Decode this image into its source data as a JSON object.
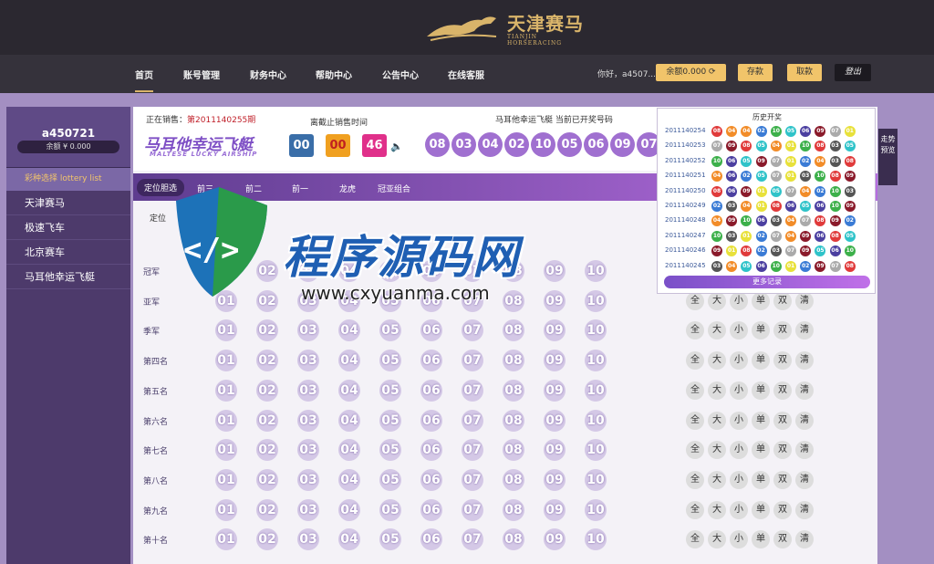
{
  "brand": {
    "name_cn": "天津赛马",
    "name_en": "TIANJIN HORSERACING"
  },
  "nav": {
    "items": [
      "首页",
      "账号管理",
      "财务中心",
      "帮助中心",
      "公告中心",
      "在线客服"
    ],
    "greeting": "你好，a4507...",
    "balance_btn": "余额0.000 ⟳",
    "deposit": "存款",
    "withdraw": "取款",
    "logout": "登出"
  },
  "sidebar": {
    "username": "a450721",
    "balance": "余额 ¥ 0.000",
    "title": "彩种选择 lottery list",
    "items": [
      "天津赛马",
      "极速飞车",
      "北京赛车",
      "马耳他幸运飞艇"
    ]
  },
  "header": {
    "on_sale_label": "正在销售：",
    "on_sale_period": "第2011140255期",
    "game_name": "马耳他幸运飞艇",
    "game_name_en": "MALTESE LUCKY AIRSHIP",
    "countdown_label": "离截止销售时间",
    "countdown": [
      "00",
      "00",
      "46"
    ],
    "current_label": "马耳他幸运飞艇 当前已开奖号码",
    "results": [
      "08",
      "03",
      "04",
      "02",
      "10",
      "05",
      "06",
      "09",
      "07"
    ]
  },
  "tabs": [
    "定位胆选",
    "前三",
    "前二",
    "前一",
    "龙虎",
    "冠亚组合"
  ],
  "subtab": "定位",
  "rows": [
    "冠军",
    "亚军",
    "季军",
    "第四名",
    "第五名",
    "第六名",
    "第七名",
    "第八名",
    "第九名",
    "第十名"
  ],
  "numbers": [
    "01",
    "02",
    "03",
    "04",
    "05",
    "06",
    "07",
    "08",
    "09",
    "10"
  ],
  "quick": [
    "全",
    "大",
    "小",
    "单",
    "双",
    "清"
  ],
  "history": {
    "title": "历史开奖",
    "more": "更多记录",
    "records": [
      {
        "id": "2011140254",
        "n": [
          "08",
          "04",
          "04",
          "02",
          "10",
          "05",
          "06",
          "09",
          "07",
          "01"
        ]
      },
      {
        "id": "2011140253",
        "n": [
          "07",
          "09",
          "08",
          "05",
          "04",
          "01",
          "10",
          "08",
          "03",
          "05"
        ]
      },
      {
        "id": "2011140252",
        "n": [
          "10",
          "06",
          "05",
          "09",
          "07",
          "01",
          "02",
          "04",
          "03",
          "08"
        ]
      },
      {
        "id": "2011140251",
        "n": [
          "04",
          "06",
          "02",
          "05",
          "07",
          "01",
          "03",
          "10",
          "08",
          "09"
        ]
      },
      {
        "id": "2011140250",
        "n": [
          "08",
          "06",
          "09",
          "01",
          "05",
          "07",
          "04",
          "02",
          "10",
          "03"
        ]
      },
      {
        "id": "2011140249",
        "n": [
          "02",
          "03",
          "04",
          "01",
          "08",
          "06",
          "05",
          "06",
          "10",
          "09"
        ]
      },
      {
        "id": "2011140248",
        "n": [
          "04",
          "09",
          "10",
          "06",
          "03",
          "04",
          "07",
          "08",
          "09",
          "02"
        ]
      },
      {
        "id": "2011140247",
        "n": [
          "10",
          "03",
          "01",
          "02",
          "07",
          "04",
          "09",
          "06",
          "08",
          "05"
        ]
      },
      {
        "id": "2011140246",
        "n": [
          "09",
          "01",
          "08",
          "02",
          "03",
          "07",
          "09",
          "05",
          "06",
          "10"
        ]
      },
      {
        "id": "2011140245",
        "n": [
          "03",
          "04",
          "05",
          "06",
          "10",
          "01",
          "02",
          "09",
          "07",
          "08"
        ]
      }
    ]
  },
  "trend": "走势预览",
  "watermark": {
    "title": "程序源码网",
    "url": "www.cxyuanma.com"
  },
  "colors": {
    "b01": "#e8e13a",
    "b02": "#3a7bd5",
    "b03": "#555555",
    "b04": "#f28c28",
    "b05": "#2fc3c9",
    "b06": "#4b3fa0",
    "b07": "#aaaaaa",
    "b08": "#e03a3a",
    "b09": "#8a1a2a",
    "b10": "#3cb04a"
  }
}
